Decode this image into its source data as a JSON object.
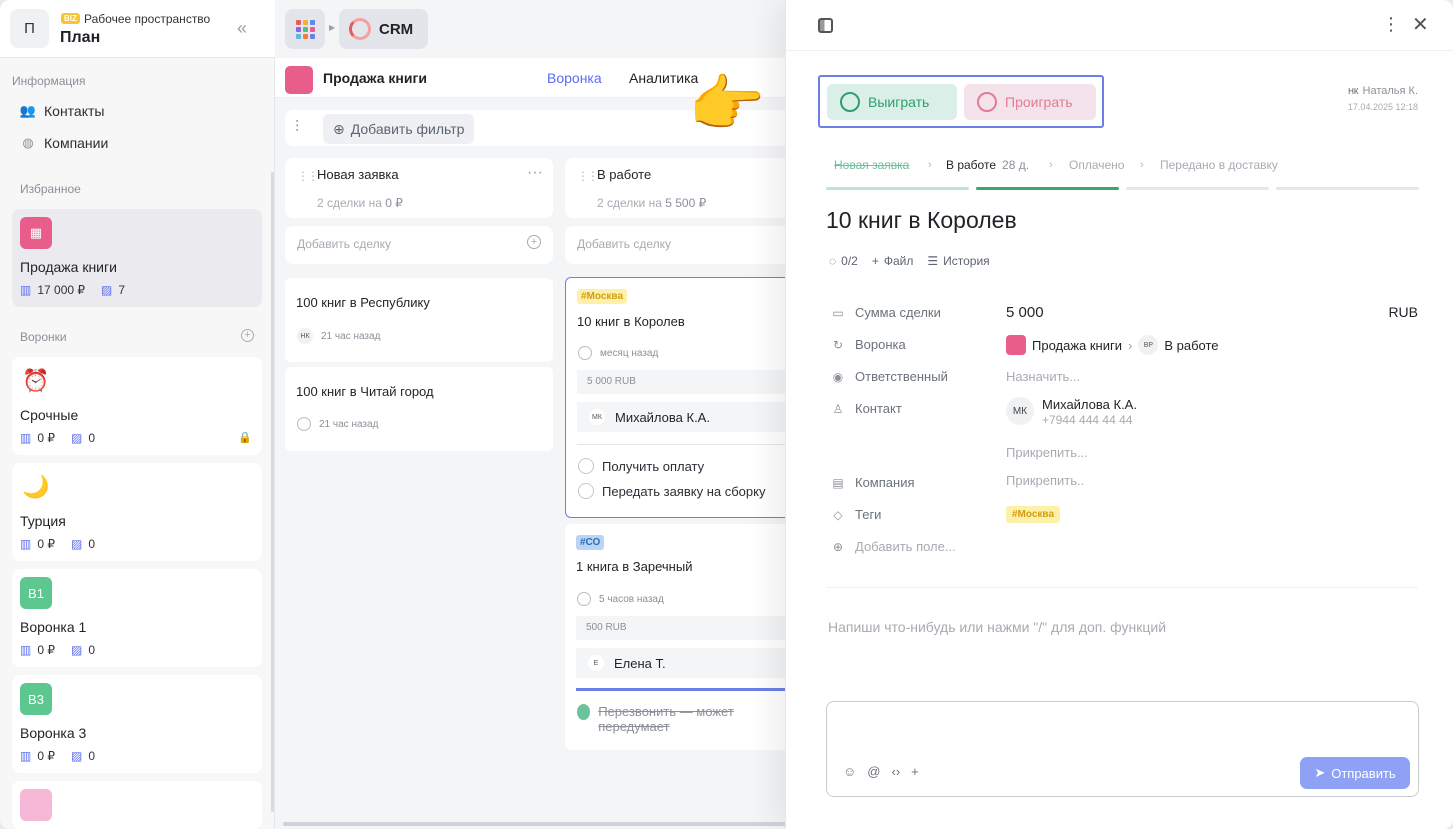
{
  "workspace": {
    "avatar_letter": "П",
    "badge": "BIZ",
    "subtitle": "Рабочее пространство",
    "name": "План",
    "collapse_icon": "double-chevron-left-icon"
  },
  "sidebar": {
    "info_title": "Информация",
    "info_items": [
      {
        "label": "Контакты",
        "icon": "users-icon"
      },
      {
        "label": "Компании",
        "icon": "globe-icon"
      }
    ],
    "favorites_title": "Избранное",
    "favorite": {
      "name": "Продажа книги",
      "amount": "17 000 ₽",
      "count": "7",
      "color": "#e85d8a"
    },
    "funnels_title": "Воронки",
    "funnels": [
      {
        "icon": "⏰",
        "name": "Срочные",
        "amount": "0 ₽",
        "count": "0",
        "locked": true
      },
      {
        "icon": "🌙",
        "name": "Турция",
        "amount": "0 ₽",
        "count": "0"
      },
      {
        "icon": "В1",
        "name": "Воронка 1",
        "amount": "0 ₽",
        "count": "0",
        "color": "#5cc890"
      },
      {
        "icon": "В3",
        "name": "Воронка 3",
        "amount": "0 ₽",
        "count": "0",
        "color": "#5cc890"
      }
    ]
  },
  "topbar": {
    "app_label": "CRM",
    "app_colors": [
      "#ee5a5a",
      "#f0b132",
      "#5b8bf0",
      "#8b62e8",
      "#4cc27f",
      "#ee5a8a",
      "#5bbbe0",
      "#f07d3c",
      "#6c7fe6"
    ]
  },
  "pipeline": {
    "title": "Продажа книги",
    "tabs": [
      "Воронка",
      "Аналитика"
    ],
    "add_filter": "Добавить фильтр"
  },
  "columns": [
    {
      "title": "Новая заявка",
      "summary_prefix": "2 сделки на ",
      "summary_amount": "0 ₽",
      "add_label": "Добавить сделку",
      "deals": [
        {
          "title": "100 книг в Республику",
          "author": "НК",
          "time": "21 час назад"
        },
        {
          "title": "100 книг в Читай город",
          "time": "21 час назад"
        }
      ]
    },
    {
      "title": "В работе",
      "summary_prefix": "2 сделки на ",
      "summary_amount": "5 500 ₽",
      "add_label": "Добавить сделку",
      "deals": [
        {
          "tag": "#Москва",
          "title": "10 книг в Королев",
          "time": "месяц назад",
          "amount": "5 000 RUB",
          "person_initials": "МК",
          "person": "Михайлова К.А.",
          "tasks": [
            "Получить оплату",
            "Передать заявку на сборку"
          ]
        },
        {
          "tag": "#СО",
          "title": "1 книга в Заречный",
          "time": "5 часов назад",
          "amount": "500 RUB",
          "person_initials": "Е",
          "person": "Елена Т.",
          "done_task": "Перезвонить — может передумает"
        }
      ]
    }
  ],
  "pointer": "👉",
  "drawer": {
    "win_label": "Выиграть",
    "lose_label": "Проиграть",
    "author_initials": "НК",
    "author_name": "Наталья К.",
    "author_date": "17.04.2025 12:18",
    "stages": [
      {
        "label": "Новая заявка",
        "state": "passed"
      },
      {
        "label": "В работе",
        "days": "28 д.",
        "state": "current"
      },
      {
        "label": "Оплачено",
        "state": "future"
      },
      {
        "label": "Передано в доставку",
        "state": "future"
      }
    ],
    "title": "10 книг в Королев",
    "tools": {
      "checklist": "0/2",
      "file": "Файл",
      "history": "История"
    },
    "fields": {
      "sum_label": "Сумма сделки",
      "sum_value": "5 000",
      "currency": "RUB",
      "funnel_label": "Воронка",
      "funnel_name": "Продажа книги",
      "stage_initials": "ВР",
      "stage_name": "В работе",
      "owner_label": "Ответственный",
      "owner_placeholder": "Назначить...",
      "contact_label": "Контакт",
      "contact_initials": "МК",
      "contact_name": "Михайлова К.А.",
      "contact_phone": "+7944 444 44 44",
      "attach_contact": "Прикрепить...",
      "company_label": "Компания",
      "attach_company": "Прикрепить..",
      "tags_label": "Теги",
      "tag_value": "#Москва",
      "add_field": "Добавить поле..."
    },
    "comment_hint": "Напиши что-нибудь или нажми \"/\" для доп. функций",
    "send_label": "Отправить"
  }
}
